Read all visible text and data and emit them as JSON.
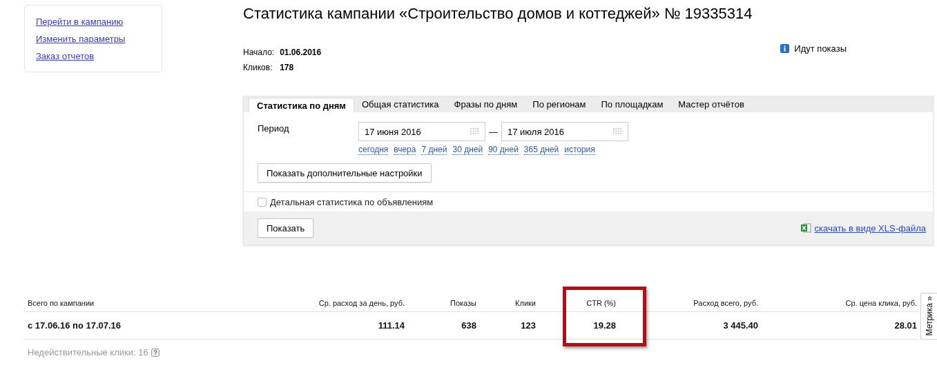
{
  "sidebar": {
    "links": [
      "Перейти в кампанию",
      "Изменить параметры",
      "Заказ отчетов"
    ]
  },
  "title": "Статистика кампании «Строительство домов и коттеджей» № 19335314",
  "summary": [
    {
      "label": "Начало:",
      "value": "01.06.2016"
    },
    {
      "label": "Кликов:",
      "value": "178"
    }
  ],
  "status": {
    "text": "Идут показы"
  },
  "tabs": [
    {
      "label": "Статистика по дням",
      "selected": true
    },
    {
      "label": "Общая статистика",
      "selected": false
    },
    {
      "label": "Фразы по дням",
      "selected": false
    },
    {
      "label": "По регионам",
      "selected": false
    },
    {
      "label": "По площадкам",
      "selected": false
    },
    {
      "label": "Мастер отчётов",
      "selected": false
    }
  ],
  "period": {
    "label": "Период",
    "from": "17 июня 2016",
    "separator": "—",
    "to": "17 июля 2016",
    "presets": [
      "сегодня",
      "вчера",
      "7 дней",
      "30 дней",
      "90 дней",
      "365 дней",
      "история"
    ]
  },
  "more_settings_button": "Показать дополнительные настройки",
  "detailed_checkbox": {
    "label": "Детальная статистика по объявлениям",
    "checked": false
  },
  "show_button": "Показать",
  "download_link": "скачать в виде XLS-файла",
  "table": {
    "columns": [
      {
        "label": "Всего по кампании",
        "highlighted": false
      },
      {
        "label": "Ср. расход за день, руб.",
        "highlighted": false
      },
      {
        "label": "Показы",
        "highlighted": false
      },
      {
        "label": "Клики",
        "highlighted": false
      },
      {
        "label": "CTR (%)",
        "highlighted": true
      },
      {
        "label": "Расход всего, руб.",
        "highlighted": false
      },
      {
        "label": "Ср. цена клика, руб.",
        "highlighted": false
      }
    ],
    "rows": [
      {
        "cells": [
          "с 17.06.16 по 17.07.16",
          "111.14",
          "638",
          "123",
          "19.28",
          "3 445.40",
          "28.01"
        ]
      }
    ]
  },
  "invalid_clicks": "Недействительные клики: 16",
  "side_tab": "Метрика »"
}
